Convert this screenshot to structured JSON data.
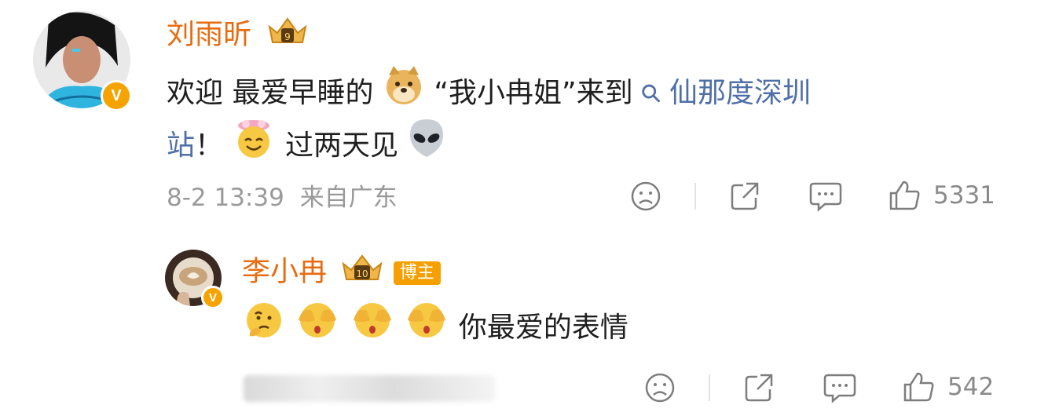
{
  "comment": {
    "author": "刘雨昕",
    "text_prefix": "欢迎 最爱早睡的",
    "text_mid": "“我小冉姐”来到",
    "search_glyph": "⚲",
    "link_text": "仙那度深圳",
    "line2_start": "站！",
    "line2_text": "过两天见",
    "time": "8-2 13:39",
    "location": "来自广东",
    "likes": "5331",
    "badge_level": "9",
    "verified_mark": "V"
  },
  "reply": {
    "author": "李小冉",
    "badge_level": "10",
    "role_tag": "博主",
    "text": "你最爱的表情",
    "likes": "542",
    "verified_mark": "V"
  },
  "colors": {
    "author": "#e86b0f",
    "link": "#4f6fa8",
    "meta": "#9a9a9a",
    "badge": "#f5a000"
  },
  "icons": [
    "sad-face-icon",
    "share-icon",
    "comment-icon",
    "thumbs-up-icon",
    "crown-badge-icon",
    "doge-emoji",
    "angel-emoji",
    "alien-emoji",
    "thinking-emoji",
    "covering-eyes-emoji"
  ]
}
